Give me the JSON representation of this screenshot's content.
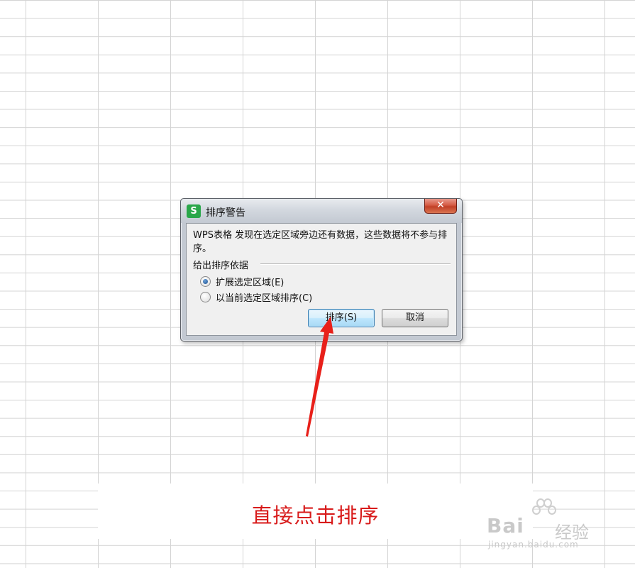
{
  "dialog": {
    "title": "排序警告",
    "app_icon_letter": "S",
    "close_glyph": "✕",
    "message": "WPS表格 发现在选定区域旁边还有数据，这些数据将不参与排序。",
    "group_label": "给出排序依据",
    "options": [
      {
        "label": "扩展选定区域(E)",
        "checked": true
      },
      {
        "label": "以当前选定区域排序(C)",
        "checked": false
      }
    ],
    "sort_button": "排序(S)",
    "cancel_button": "取消"
  },
  "annotation": {
    "caption": "直接点击排序",
    "arrow_color": "#e8201a"
  },
  "watermark": {
    "brand": "Bai",
    "brand_suffix": "经验",
    "url": "jingyan.baidu.com"
  }
}
